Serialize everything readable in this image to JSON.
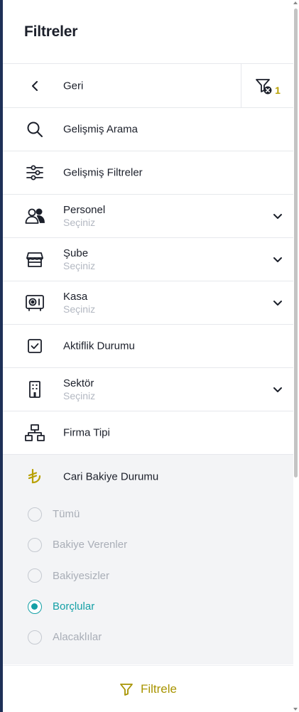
{
  "header": {
    "title": "Filtreler"
  },
  "back": {
    "label": "Geri",
    "active_filter_count": "1"
  },
  "menu": [
    {
      "label": "Gelişmiş Arama",
      "icon": "search-icon"
    },
    {
      "label": "Gelişmiş Filtreler",
      "icon": "sliders-icon"
    },
    {
      "label": "Personel",
      "sub": "Seçiniz",
      "icon": "users-icon",
      "expandable": true
    },
    {
      "label": "Şube",
      "sub": "Seçiniz",
      "icon": "store-icon",
      "expandable": true
    },
    {
      "label": "Kasa",
      "sub": "Seçiniz",
      "icon": "safe-icon",
      "expandable": true
    },
    {
      "label": "Aktiflik Durumu",
      "icon": "checkbox-icon"
    },
    {
      "label": "Sektör",
      "sub": "Seçiniz",
      "icon": "building-icon",
      "expandable": true
    },
    {
      "label": "Firma Tipi",
      "icon": "network-icon"
    }
  ],
  "cari": {
    "label": "Cari Bakiye Durumu",
    "icon": "lira-icon",
    "options": [
      {
        "label": "Tümü",
        "checked": false
      },
      {
        "label": "Bakiye Verenler",
        "checked": false
      },
      {
        "label": "Bakiyesizler",
        "checked": false
      },
      {
        "label": "Borçlular",
        "checked": true
      },
      {
        "label": "Alacaklılar",
        "checked": false
      }
    ]
  },
  "footer": {
    "button_label": "Filtrele"
  },
  "colors": {
    "accent": "#14a0a6",
    "gold": "#b8a000",
    "nav_edge": "#1e3057"
  }
}
